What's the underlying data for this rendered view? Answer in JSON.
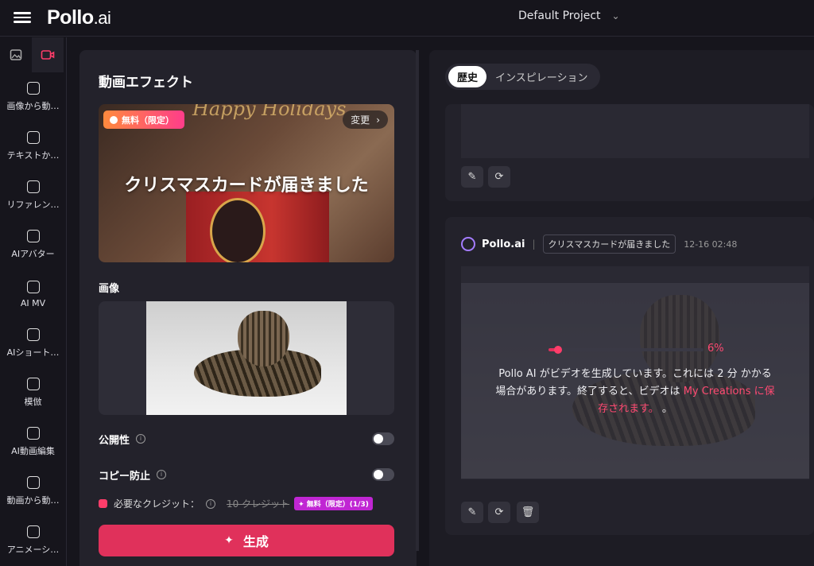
{
  "header": {
    "logo_main": "Pollo",
    "logo_suffix": ".ai",
    "project": "Default Project"
  },
  "sidebar": {
    "items": [
      {
        "label": "画像から動…",
        "icon": "image-video-icon"
      },
      {
        "label": "テキストか…",
        "icon": "text-video-icon"
      },
      {
        "label": "リファレン…",
        "icon": "reference-icon"
      },
      {
        "label": "AIアバター",
        "icon": "avatar-icon"
      },
      {
        "label": "AI MV",
        "icon": "music-video-icon"
      },
      {
        "label": "AIショート…",
        "icon": "short-video-icon"
      },
      {
        "label": "模倣",
        "icon": "dance-icon"
      },
      {
        "label": "AI動画編集",
        "icon": "video-edit-icon"
      },
      {
        "label": "動画から動…",
        "icon": "video-video-icon"
      },
      {
        "label": "アニメーシ…",
        "icon": "animation-icon"
      }
    ]
  },
  "left_panel": {
    "title": "動画エフェクト",
    "effect": {
      "badge": "無料（限定）",
      "change_label": "変更",
      "caption": "クリスマスカードが届きました",
      "bg_text": "Happy Holidays"
    },
    "image_label": "画像",
    "public_label": "公開性",
    "copy_protect_label": "コピー防止",
    "credits_label": "必要なクレジット：",
    "credits_strike": "10 クレジット",
    "credits_free": "✦ 無料（限定）(1/3)",
    "generate_label": "生成"
  },
  "right_panel": {
    "tabs": [
      "歴史",
      "インスピレーション"
    ],
    "card2": {
      "brand": "Pollo.ai",
      "chip": "クリスマスカードが届きました",
      "time": "12-16 02:48",
      "progress": 0.06,
      "progress_label": "6%",
      "msg_line1": "Pollo AI がビデオを生成しています。これには 2 分 かかる",
      "msg_line2_a": "場合があります。終了すると、ビデオは ",
      "msg_line2_hl": "My Creations に保",
      "msg_line3_hl": "存されます。",
      "msg_line3_tail": " 。"
    }
  },
  "colors": {
    "accent": "#e0315b",
    "bg": "#16151c",
    "panel": "#23222b"
  }
}
